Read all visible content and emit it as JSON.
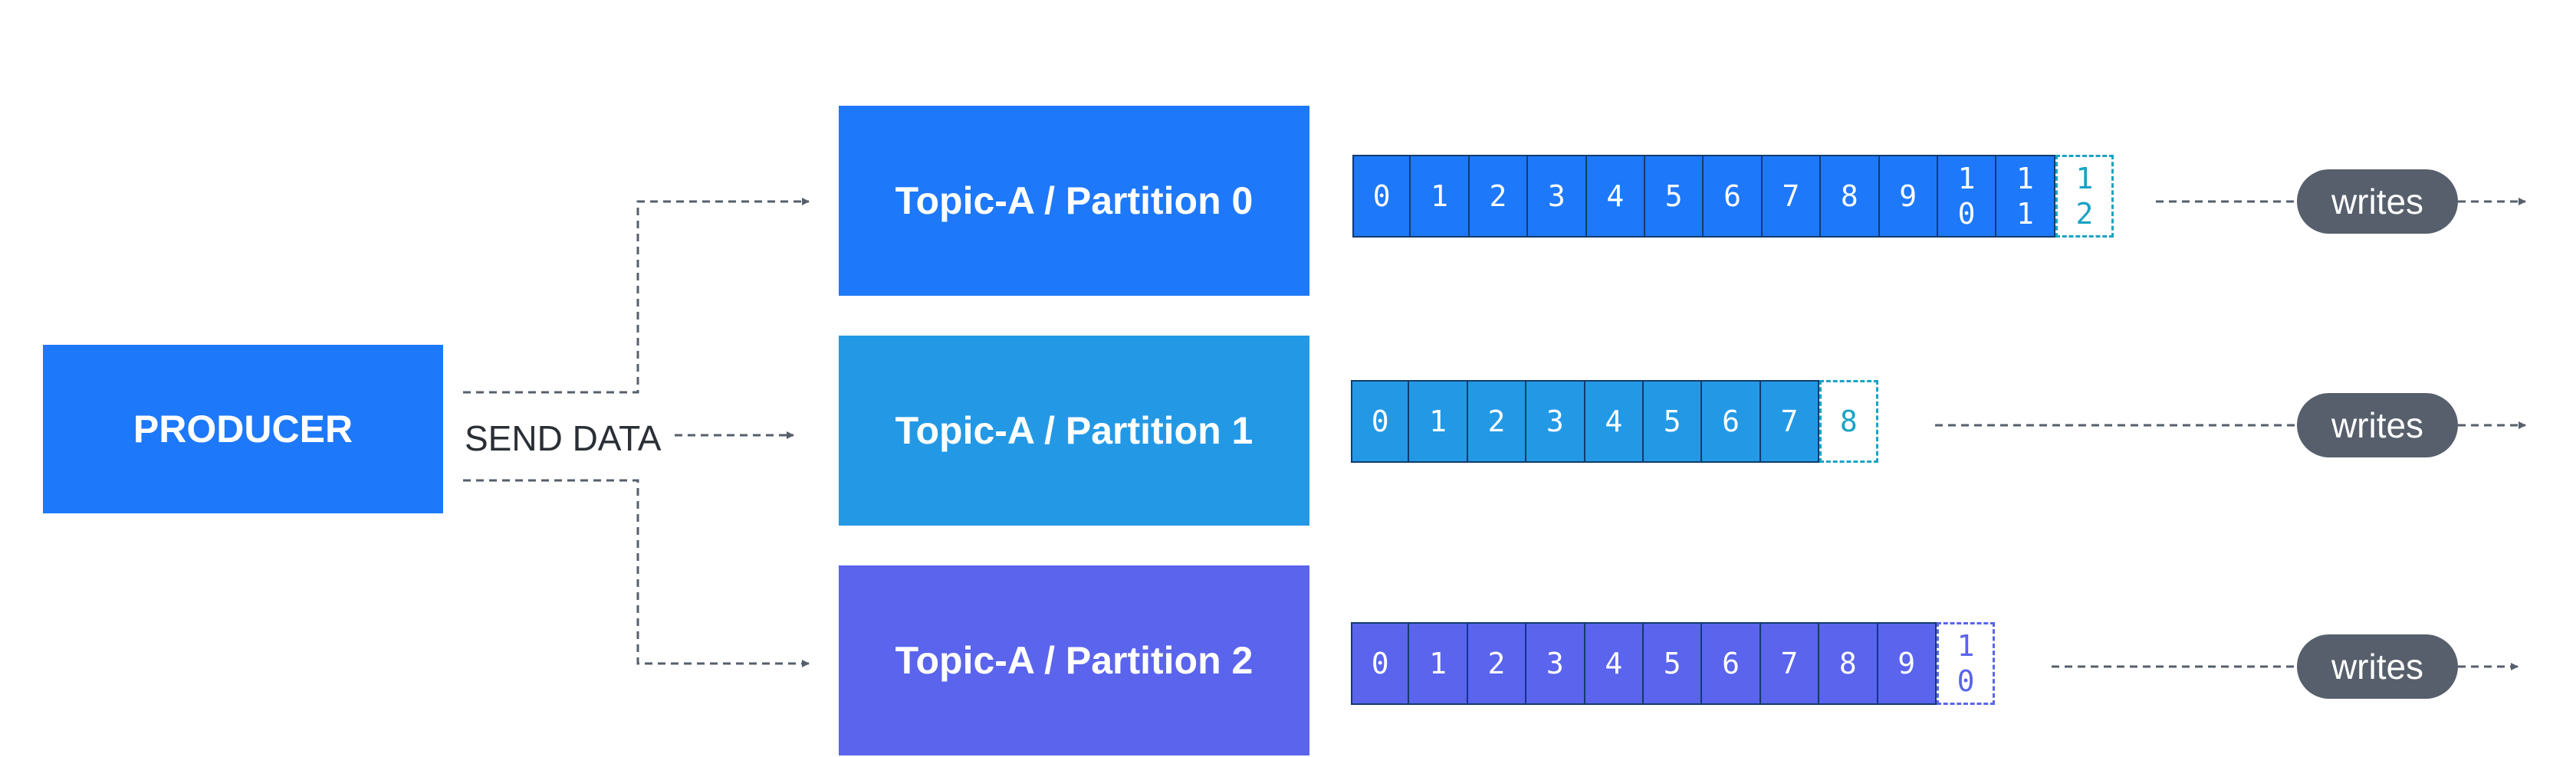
{
  "producer": {
    "label": "PRODUCER",
    "color": "#1e78fa"
  },
  "send_label": "SEND DATA",
  "line_color": "#565f6b",
  "partitions": [
    {
      "label": "Topic-A / Partition 0",
      "color": "#1e78fa",
      "cells": [
        "0",
        "1",
        "2",
        "3",
        "4",
        "5",
        "6",
        "7",
        "8",
        "9",
        "1\n0",
        "1\n1"
      ],
      "next": "1\n2",
      "next_color": "#1aa3c4",
      "writes": "writes"
    },
    {
      "label": "Topic-A / Partition 1",
      "color": "#2399e6",
      "cells": [
        "0",
        "1",
        "2",
        "3",
        "4",
        "5",
        "6",
        "7"
      ],
      "next": "8",
      "next_color": "#1aa3c4",
      "writes": "writes"
    },
    {
      "label": "Topic-A / Partition 2",
      "color": "#5a64ec",
      "cells": [
        "0",
        "1",
        "2",
        "3",
        "4",
        "5",
        "6",
        "7",
        "8",
        "9"
      ],
      "next": "1\n0",
      "next_color": "#5a64ec",
      "writes": "writes"
    }
  ]
}
